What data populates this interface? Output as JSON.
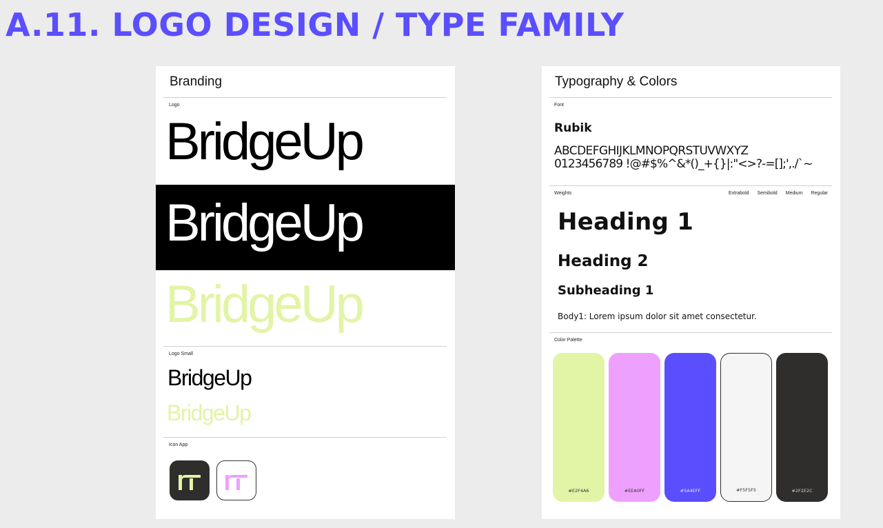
{
  "title": "A.11.  LOGO DESIGN / TYPE FAMILY",
  "branding": {
    "heading": "Branding",
    "logo_label": "Logo",
    "logo_text": "BridgeUp",
    "logo_small_label": "Logo Small",
    "icon_app_label": "Icon App",
    "colors": {
      "dark": "#000000",
      "light": "#ffffff",
      "lime": "#e2f4a6"
    }
  },
  "typography": {
    "heading": "Typography & Colors",
    "font_label": "Font",
    "font_name": "Rubik",
    "alphabet": "ABCDEFGHIJKLMNOPQRSTUVWXYZ",
    "numbers_symbols": "0123456789 !@#$%^&*()_+{}|:\"<>?-=[];',./`~",
    "weights_label": "Weights",
    "weight_options": [
      "Extrabold",
      "Semibold",
      "Medium",
      "Regular"
    ],
    "samples": {
      "heading1": "Heading 1",
      "heading2": "Heading 2",
      "subheading1": "Subheading 1",
      "body1": "Body1: Lorem ipsum dolor sit amet consectetur."
    },
    "palette_label": "Color Palette",
    "palette": [
      {
        "hex": "#E2F4A6",
        "color": "#e2f4a6"
      },
      {
        "hex": "#EEA0FF",
        "color": "#eea0ff"
      },
      {
        "hex": "#5A4EFF",
        "color": "#5a4eff"
      },
      {
        "hex": "#F5F5F5",
        "color": "#f5f5f5"
      },
      {
        "hex": "#2F2E2C",
        "color": "#2f2e2c"
      }
    ]
  }
}
